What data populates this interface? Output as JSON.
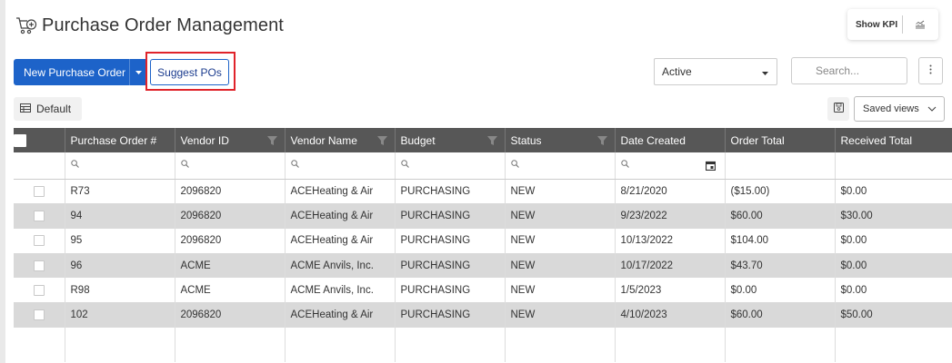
{
  "header": {
    "title": "Purchase Order Management",
    "title_icon": "cart-add-icon",
    "kpi_label": "Show KPI",
    "kpi_icon": "chart-icon"
  },
  "toolbar": {
    "new_po_label": "New Purchase Order",
    "suggest_label": "Suggest POs",
    "status_value": "Active",
    "search_placeholder": "Search...",
    "default_view_label": "Default",
    "saved_views_label": "Saved views"
  },
  "colors": {
    "primary": "#1d63c9",
    "highlight": "#e0232a",
    "header_bg": "#575757",
    "alt_row": "#d9d9d9",
    "negative": "#e0232a"
  },
  "table": {
    "columns": [
      "Purchase Order #",
      "Vendor ID",
      "Vendor Name",
      "Budget",
      "Status",
      "Date Created",
      "Order Total",
      "Received Total"
    ],
    "rows": [
      [
        "R73",
        "2096820",
        "ACEHeating & Air",
        "PURCHASING",
        "NEW",
        "8/21/2020",
        "($15.00)",
        "$0.00"
      ],
      [
        "94",
        "2096820",
        "ACEHeating & Air",
        "PURCHASING",
        "NEW",
        "9/23/2022",
        "$60.00",
        "$30.00"
      ],
      [
        "95",
        "2096820",
        "ACEHeating & Air",
        "PURCHASING",
        "NEW",
        "10/13/2022",
        "$104.00",
        "$0.00"
      ],
      [
        "96",
        "ACME",
        "ACME Anvils, Inc.",
        "PURCHASING",
        "NEW",
        "10/17/2022",
        "$43.70",
        "$0.00"
      ],
      [
        "R98",
        "ACME",
        "ACME Anvils, Inc.",
        "PURCHASING",
        "NEW",
        "1/5/2023",
        "$0.00",
        "$0.00"
      ],
      [
        "102",
        "2096820",
        "ACEHeating & Air",
        "PURCHASING",
        "NEW",
        "4/10/2023",
        "$60.00",
        "$50.00"
      ]
    ]
  }
}
